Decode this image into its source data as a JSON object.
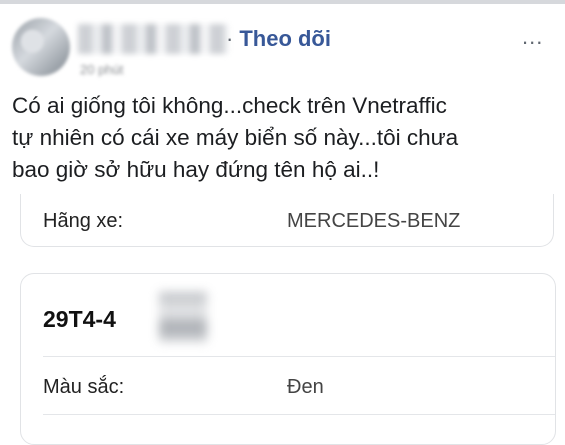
{
  "post": {
    "follow_label": "Theo dõi",
    "more_label": "...",
    "time_text": "20 phút",
    "text": "Có ai giống tôi không...check trên Vnetraffic\ntự nhiên có cái xe máy biển số này...tôi chưa\nbao giờ sở hữu hay đứng tên hộ ai..!"
  },
  "vehicle_card": {
    "brand_label": "Hãng xe:",
    "brand_value": "MERCEDES-BENZ"
  },
  "plate_card": {
    "plate": "29T4-4",
    "color_label": "Màu sắc:",
    "color_value": "Đen"
  }
}
